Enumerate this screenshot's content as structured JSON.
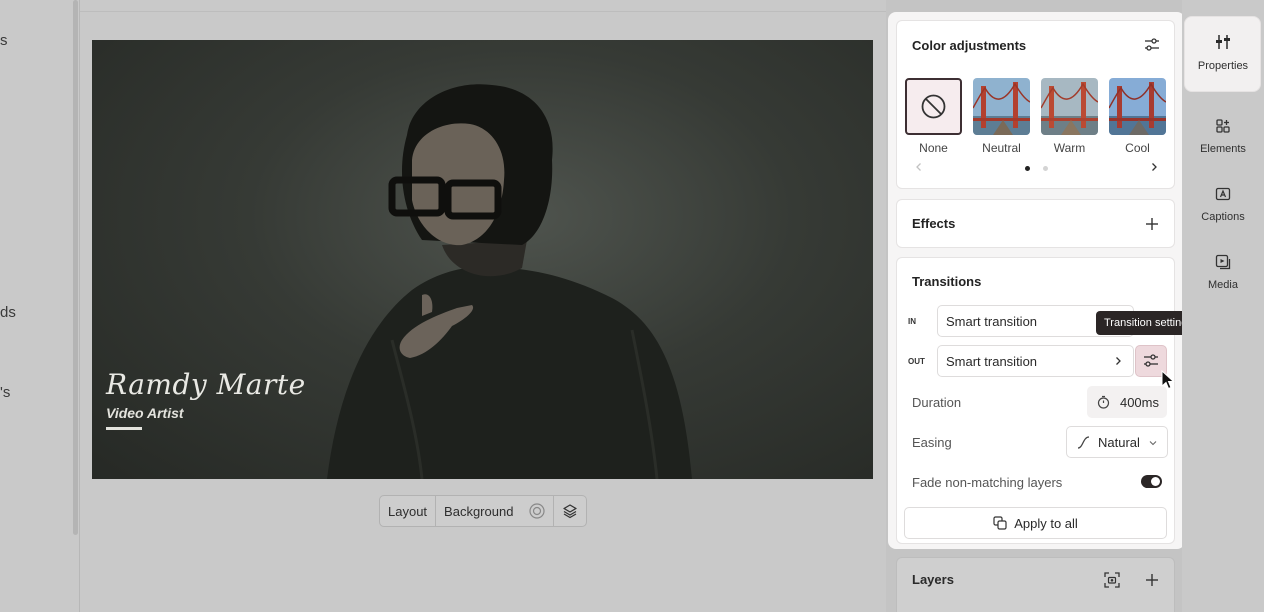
{
  "left_sidebar": {
    "fragments": [
      "s",
      "ds",
      "'s"
    ]
  },
  "video": {
    "lower_third_name": "Ramdy Marte",
    "lower_third_role": "Video Artist"
  },
  "canvas_toolbar": {
    "layout_label": "Layout",
    "background_label": "Background"
  },
  "color_adjustments": {
    "title": "Color adjustments",
    "presets": [
      {
        "label": "None",
        "selected": true
      },
      {
        "label": "Neutral",
        "selected": false
      },
      {
        "label": "Warm",
        "selected": false
      },
      {
        "label": "Cool",
        "selected": false
      }
    ],
    "page": 1,
    "page_count": 2
  },
  "effects": {
    "title": "Effects"
  },
  "transitions": {
    "title": "Transitions",
    "in_tag": "IN",
    "out_tag": "OUT",
    "in_value": "Smart transition",
    "out_value": "Smart transition",
    "tooltip": "Transition settings",
    "duration_label": "Duration",
    "duration_value": "400ms",
    "easing_label": "Easing",
    "easing_value": "Natural",
    "fade_label": "Fade non-matching layers",
    "fade_on": true,
    "apply_label": "Apply to all"
  },
  "layers": {
    "title": "Layers"
  },
  "nav": {
    "items": [
      {
        "label": "Properties",
        "icon": "properties-icon",
        "active": true
      },
      {
        "label": "Elements",
        "icon": "elements-icon",
        "active": false
      },
      {
        "label": "Captions",
        "icon": "captions-icon",
        "active": false
      },
      {
        "label": "Media",
        "icon": "media-icon",
        "active": false
      }
    ]
  },
  "colors": {
    "accent": "#2b2626",
    "selected_border": "#3d2f33",
    "settings_active_bg": "#eed9dd"
  }
}
